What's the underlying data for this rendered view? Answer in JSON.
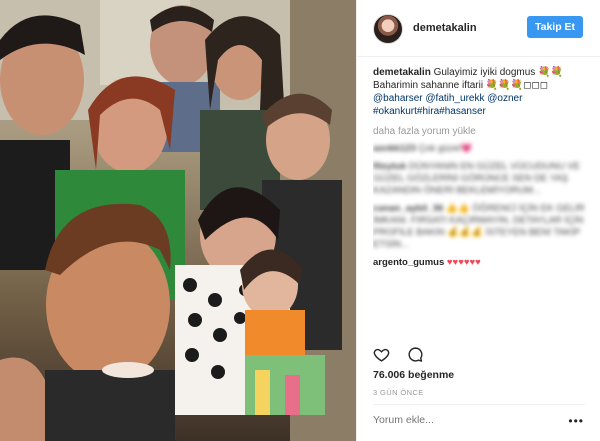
{
  "post": {
    "username": "demetakalin",
    "follow_label": "Takip Et",
    "caption_user": "demetakalin",
    "caption_text": "Gulayimiz iyiki dogmus 💐💐 Baharimin sahanne iftarii 💐💐💐◻◻◻",
    "caption_tags": "@baharser @fatih_urekk @ozner #okankurt#hira#hasanser",
    "more_comments": "daha fazla yorum yükle",
    "comments": [
      {
        "user": "asnkk123",
        "text": "Çok güzel💗"
      },
      {
        "user": "fileytuk",
        "text": "DÜNYANIN EN GÜZEL VÜCUDUNU VE GÜZEL GÖZLERİNİ GÖRÜNCE SEN DE YAŞ KAZANDIN ÖNERİ BEKLEMİYORUM..."
      },
      {
        "user": "canan_aybil_36",
        "text": "👍👍 ÖĞRENCİ İÇİN EK GELİR İMKANI. FIRSATI KAÇIRMAYIN, DETAYLAR İÇİN PROFİLE BAKIN 💰💰💰 İSTEYEN BENİ TAKİP ETSİN..."
      },
      {
        "user": "argento_gumus",
        "text": "♥♥♥♥♥♥"
      }
    ],
    "likes": "76.006 beğenme",
    "time": "3 GÜN ÖNCE",
    "comment_placeholder": "Yorum ekle...",
    "more_dots": "•••"
  },
  "icons": {
    "heart": "heart-icon",
    "comment": "comment-icon"
  },
  "colors": {
    "follow_button": "#3897f0",
    "link": "#003569"
  }
}
